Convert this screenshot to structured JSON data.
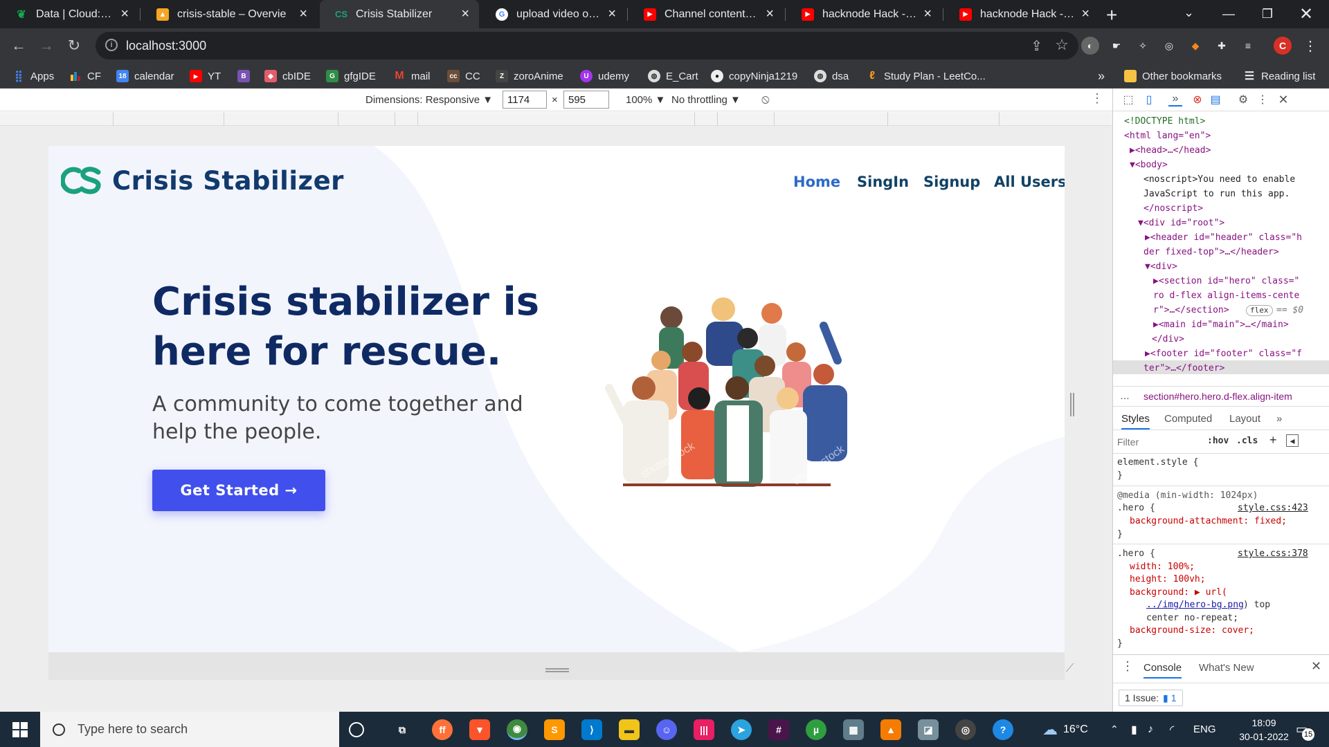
{
  "browser": {
    "tabs": [
      {
        "title": "Data | Cloud: MongoD",
        "icon": "mongodb-leaf-icon",
        "color": "#13aa52",
        "active": false
      },
      {
        "title": "crisis-stable – Overvie",
        "icon": "firebase-icon",
        "color": "#f5a623",
        "active": false
      },
      {
        "title": "Crisis Stabilizer",
        "icon": "crisis-stabilizer-favicon",
        "color": "#1aa17d",
        "active": true
      },
      {
        "title": "upload video on yout",
        "icon": "google-icon",
        "color": "#ffffff",
        "active": false
      },
      {
        "title": "Channel content - You",
        "icon": "youtube-icon",
        "color": "#ff0000",
        "active": false
      },
      {
        "title": "hacknode Hack - You",
        "icon": "youtube-icon",
        "color": "#ff0000",
        "active": false
      },
      {
        "title": "hacknode Hack - You",
        "icon": "youtube-icon",
        "color": "#ff0000",
        "active": false
      }
    ],
    "new_tab": "+",
    "url": "localhost:3000",
    "bookmarks": [
      {
        "label": "Apps",
        "icon": "apps-grid-icon",
        "color": "#4285f4"
      },
      {
        "label": "CF",
        "icon": "codeforces-icon",
        "color": "#1f8acb"
      },
      {
        "label": "calendar",
        "icon": "calendar-icon",
        "color": "#4285f4"
      },
      {
        "label": "YT",
        "icon": "youtube-icon",
        "color": "#ff0000"
      },
      {
        "label": "",
        "icon": "bootstrap-icon",
        "color": "#7952b3"
      },
      {
        "label": "cbIDE",
        "icon": "cbide-icon",
        "color": "#e35d6a"
      },
      {
        "label": "gfgIDE",
        "icon": "gfg-icon",
        "color": "#2f8d46"
      },
      {
        "label": "mail",
        "icon": "gmail-icon",
        "color": "#ea4335"
      },
      {
        "label": "CC",
        "icon": "codechef-icon",
        "color": "#6b4f3a"
      },
      {
        "label": "zoroAnime",
        "icon": "zoro-icon",
        "color": "#444"
      },
      {
        "label": "udemy",
        "icon": "udemy-icon",
        "color": "#a435f0"
      },
      {
        "label": "E_Cart",
        "icon": "globe-icon",
        "color": "#888"
      },
      {
        "label": "copyNinja1219",
        "icon": "github-icon",
        "color": "#333"
      },
      {
        "label": "dsa",
        "icon": "globe-icon",
        "color": "#888"
      },
      {
        "label": "Study Plan - LeetCo...",
        "icon": "leetcode-icon",
        "color": "#f89f1b"
      }
    ],
    "more_bookmarks": "»",
    "other_bookmarks": "Other bookmarks",
    "reading_list": "Reading list"
  },
  "device_toolbar": {
    "dimensions_label": "Dimensions: Responsive ▼",
    "width": "1174",
    "times": "×",
    "height": "595",
    "zoom": "100% ▼",
    "throttling": "No throttling ▼"
  },
  "site": {
    "brand": "Crisis Stabilizer",
    "logo_text": "CS",
    "nav": [
      "Home",
      "SingIn",
      "Signup",
      "All Users"
    ],
    "hero_title": "Crisis stabilizer is here for rescue.",
    "hero_subtitle": "A community to come together and help the people.",
    "cta": "Get Started →",
    "watermark": "shutterstock",
    "colors": {
      "accent": "#4150ec",
      "title": "#0f2a63",
      "nav": "#124265",
      "nav_active": "#2d69c9",
      "logo": "#1aa17d"
    }
  },
  "devtools": {
    "elements": [
      "<!DOCTYPE html>",
      "<html lang=\"en\">",
      "▶<head>…</head>",
      "▼<body>",
      "<noscript>You need to enable",
      "JavaScript to run this app.",
      "</noscript>",
      "▼<div id=\"root\">",
      "▶<header id=\"header\" class=\"h",
      "der fixed-top\">…</header>",
      "▼<div>",
      "▶<section id=\"hero\" class=\"",
      "ro d-flex align-items-cente",
      "r\">…</section>",
      "▶<main id=\"main\">…</main>",
      "</div>",
      "▶<footer id=\"footer\" class=\"f",
      "ter\">…</footer>"
    ],
    "flex_badge": "flex",
    "selected_marker": "== $0",
    "breadcrumb": "section#hero.hero.d-flex.align-item",
    "tabs": [
      "Styles",
      "Computed",
      "Layout",
      "»"
    ],
    "filter_placeholder": "Filter",
    "hov": ":hov",
    "cls": ".cls",
    "styles": [
      "element.style {",
      "}",
      "@media (min-width: 1024px)",
      ".hero {",
      "style.css:423",
      "background-attachment: fixed;",
      "}",
      ".hero {",
      "style.css:378",
      "width: 100%;",
      "height: 100vh;",
      "background: ▶ url(",
      "../img/hero-bg.png",
      ") top",
      "center no-repeat;",
      "background-size: cover;",
      "}"
    ],
    "drawer_tabs": [
      "Console",
      "What's New"
    ],
    "issues": "1 Issue:",
    "issue_count": "1"
  },
  "taskbar": {
    "search_placeholder": "Type here to search",
    "weather": "16°C",
    "language": "ENG",
    "time": "18:09",
    "date": "30-01-2022",
    "notifications": "15"
  }
}
